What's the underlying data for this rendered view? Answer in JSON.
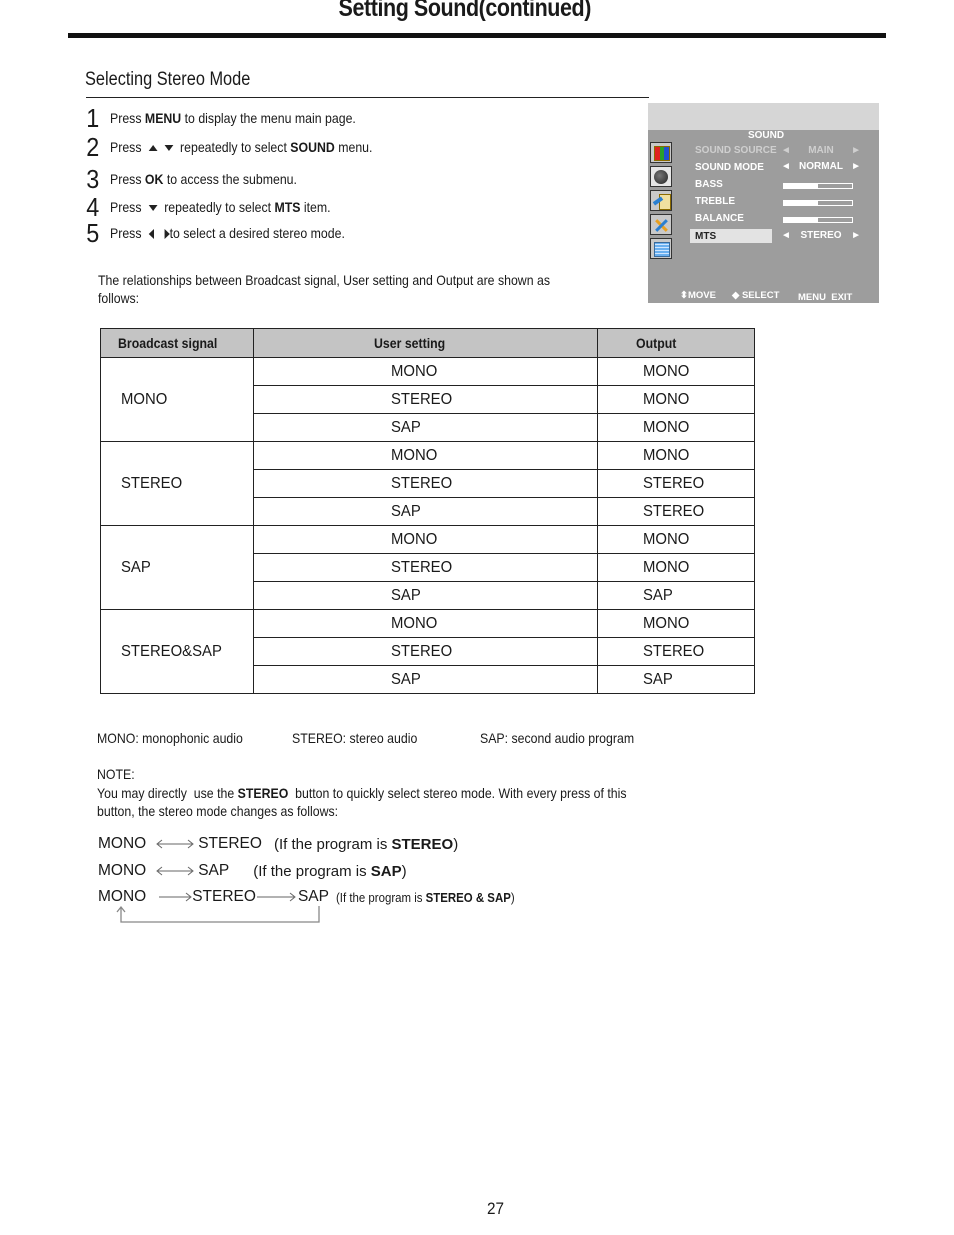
{
  "page": {
    "title": "Setting Sound(continued)",
    "page_number": "27"
  },
  "section": {
    "heading": "Selecting Stereo Mode"
  },
  "steps": [
    {
      "num": "1",
      "pre": "Press ",
      "bold": "MENU",
      "post": " to display the menu main page.",
      "icons": []
    },
    {
      "num": "2",
      "pre": "Press ",
      "icons": [
        "up-arrow",
        "down-arrow"
      ],
      "mid": " repeatedly to select ",
      "bold": "SOUND",
      "post": " menu."
    },
    {
      "num": "3",
      "pre": "Press ",
      "bold": "OK",
      "post": " to access the submenu.",
      "icons": []
    },
    {
      "num": "4",
      "pre": "Press ",
      "icons": [
        "down-arrow"
      ],
      "mid": " repeatedly to select ",
      "bold": "MTS",
      "post": " item."
    },
    {
      "num": "5",
      "pre": "Press ",
      "icons": [
        "left-arrow",
        "right-arrow"
      ],
      "post": "to select a desired stereo mode."
    }
  ],
  "osd_menu": {
    "title": "SOUND",
    "side_icons": [
      "picture-icon",
      "sound-icon",
      "function-icon",
      "setup-icon",
      "channel-icon"
    ],
    "items": [
      {
        "label": "SOUND SOURCE",
        "value": "MAIN",
        "type": "select",
        "disabled": true
      },
      {
        "label": "SOUND MODE",
        "value": "NORMAL",
        "type": "select",
        "disabled": false
      },
      {
        "label": "BASS",
        "type": "slider",
        "level_percent": 50
      },
      {
        "label": "TREBLE",
        "type": "slider",
        "level_percent": 50
      },
      {
        "label": "BALANCE",
        "type": "slider",
        "level_percent": 50
      },
      {
        "label": "MTS",
        "value": "STEREO",
        "type": "select",
        "selected": true
      }
    ],
    "footer": {
      "move": "MOVE",
      "select": "SELECT",
      "menu_exit": "MENU  EXIT"
    }
  },
  "relationship_text": "The relationships between Broadcast signal, User setting and Output are shown as follows:",
  "table": {
    "headers": [
      "Broadcast signal",
      "User setting",
      "Output"
    ],
    "groups": [
      {
        "signal": "MONO",
        "rows": [
          {
            "user": "MONO",
            "output": "MONO"
          },
          {
            "user": "STEREO",
            "output": "MONO"
          },
          {
            "user": "SAP",
            "output": "MONO"
          }
        ]
      },
      {
        "signal": "STEREO",
        "rows": [
          {
            "user": "MONO",
            "output": "MONO"
          },
          {
            "user": "STEREO",
            "output": "STEREO"
          },
          {
            "user": "SAP",
            "output": "STEREO"
          }
        ]
      },
      {
        "signal": "SAP",
        "rows": [
          {
            "user": "MONO",
            "output": "MONO"
          },
          {
            "user": "STEREO",
            "output": "MONO"
          },
          {
            "user": "SAP",
            "output": "SAP"
          }
        ]
      },
      {
        "signal": "STEREO&SAP",
        "rows": [
          {
            "user": "MONO",
            "output": "MONO"
          },
          {
            "user": "STEREO",
            "output": "STEREO"
          },
          {
            "user": "SAP",
            "output": "SAP"
          }
        ]
      }
    ]
  },
  "legend": [
    "MONO: monophonic audio",
    "STEREO: stereo audio",
    "SAP: second audio program"
  ],
  "note": {
    "label": "NOTE:",
    "pre": "You may directly  use the ",
    "bold": "STEREO",
    "post": "  button to quickly select stereo mode. With every press of this button, the stereo mode changes as follows:"
  },
  "sequences": [
    {
      "items": [
        "MONO",
        "STEREO"
      ],
      "arrow": "both",
      "note_pre": "(If the program is ",
      "note_bold": "STEREO",
      "note_post": ")"
    },
    {
      "items": [
        "MONO",
        "SAP"
      ],
      "arrow": "both",
      "note_pre": "(If the program is ",
      "note_bold": "SAP",
      "note_post": ")"
    },
    {
      "items": [
        "MONO",
        "STEREO",
        "SAP"
      ],
      "arrow": "cycle",
      "note_pre": "(If the program is ",
      "note_bold": "STEREO & SAP",
      "note_post": ")"
    }
  ]
}
